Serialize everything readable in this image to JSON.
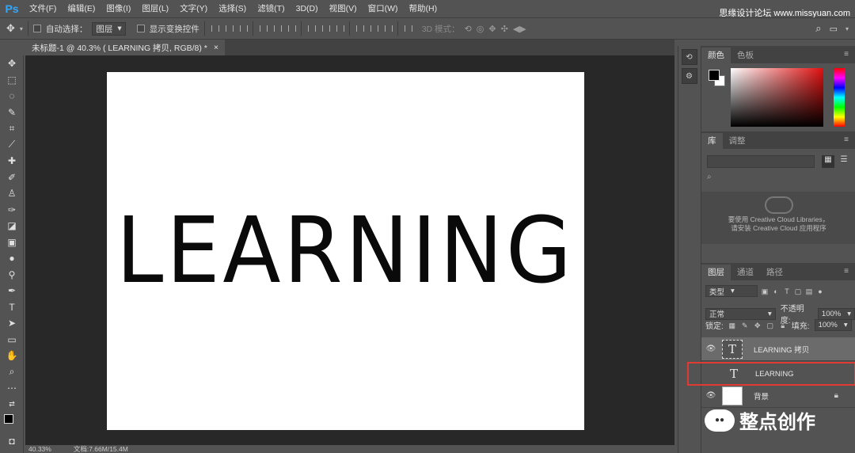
{
  "app": {
    "logo": "Ps"
  },
  "menu": [
    "文件(F)",
    "编辑(E)",
    "图像(I)",
    "图层(L)",
    "文字(Y)",
    "选择(S)",
    "滤镜(T)",
    "3D(D)",
    "视图(V)",
    "窗口(W)",
    "帮助(H)"
  ],
  "watermark_top": "思缘设计论坛 www.missyuan.com",
  "options": {
    "auto_select_label": "自动选择：",
    "auto_select_value": "图层",
    "show_transform_label": "显示变换控件",
    "mode3d_label": "3D 模式："
  },
  "doc": {
    "tab_title": "未标题-1 @ 40.3% ( LEARNING 拷贝, RGB/8) *",
    "close": "×",
    "canvas_text": "LEARNING"
  },
  "status": {
    "zoom": "40.33%",
    "doc_size": "文档:7.66M/15.4M"
  },
  "color_panel": {
    "tabs": [
      "颜色",
      "色板"
    ],
    "fg": "#000000",
    "bg": "#ffffff"
  },
  "library_panel": {
    "tabs": [
      "库",
      "调整"
    ],
    "cc_line1": "要使用 Creative Cloud Libraries，",
    "cc_line2": "请安装 Creative Cloud 应用程序"
  },
  "layers_panel": {
    "tabs": [
      "图层",
      "通道",
      "路径"
    ],
    "filter_label": "类型",
    "blend_mode": "正常",
    "opacity_label": "不透明度:",
    "opacity_value": "100%",
    "lock_label": "锁定:",
    "fill_label": "填充:",
    "fill_value": "100%",
    "layers": [
      {
        "name": "LEARNING 拷贝",
        "type": "text",
        "visible": true,
        "selected": true
      },
      {
        "name": "LEARNING",
        "type": "text",
        "visible": false,
        "highlighted": true
      },
      {
        "name": "背景",
        "type": "image",
        "visible": true,
        "locked": true
      }
    ]
  },
  "watermark_bottom": "整点创作"
}
